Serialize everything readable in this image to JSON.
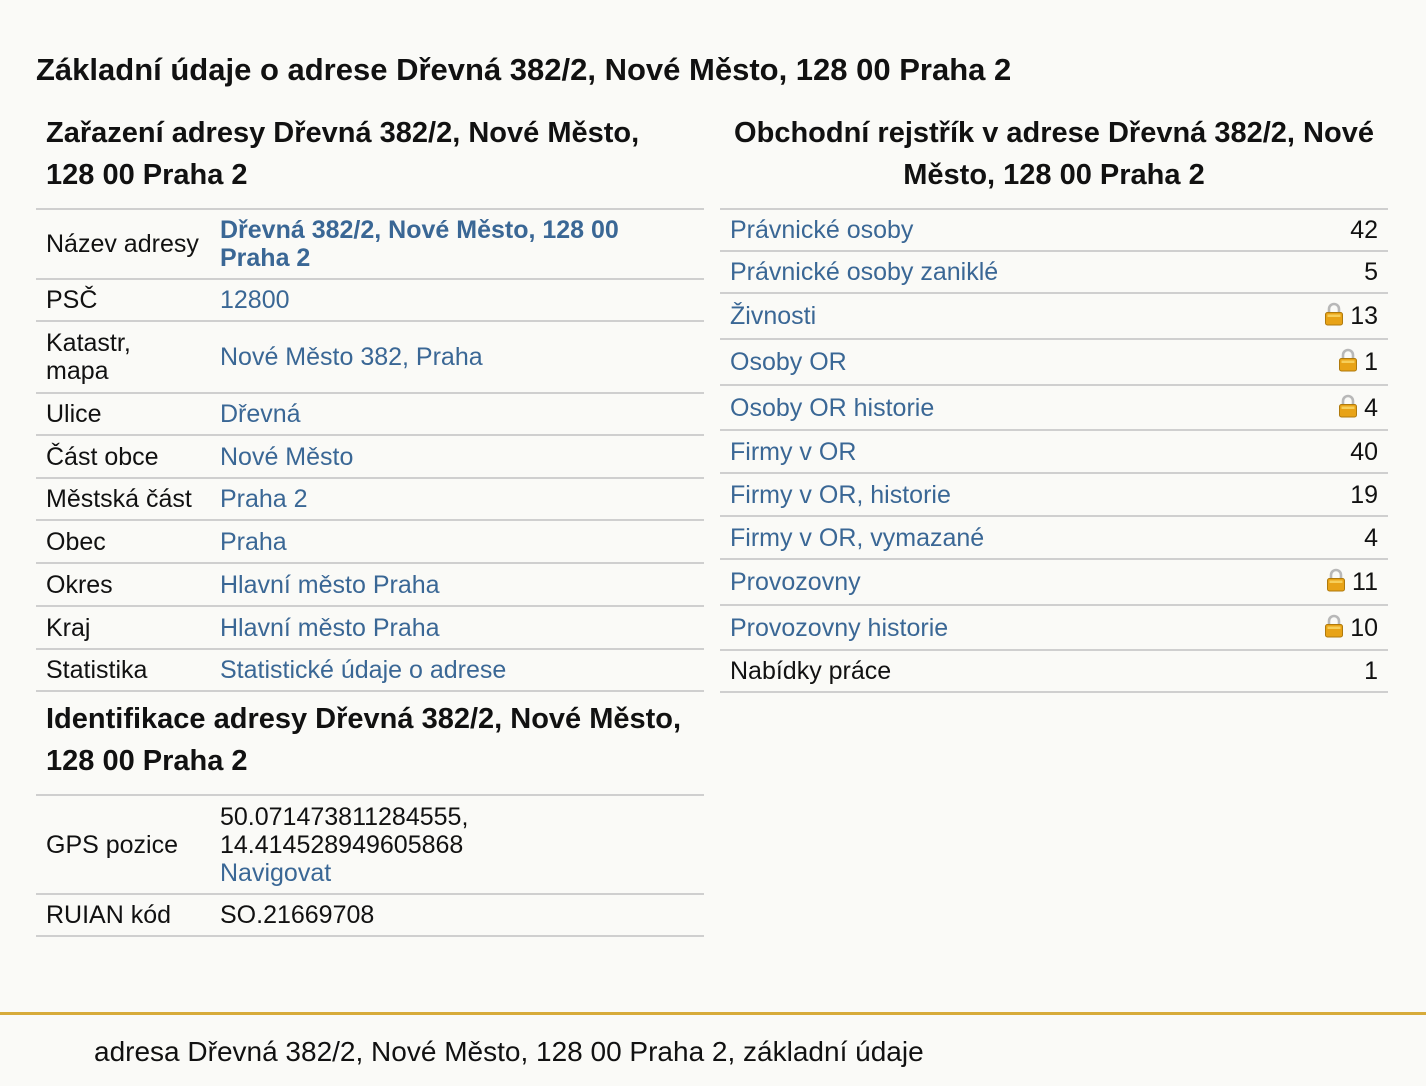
{
  "page": {
    "title": "Základní údaje o adrese Dřevná 382/2, Nové Město, 128 00 Praha 2",
    "footer": "adresa Dřevná 382/2, Nové Město, 128 00 Praha 2, základní údaje"
  },
  "classification": {
    "title": "Zařazení adresy Dřevná 382/2, Nové Město, 128 00 Praha 2",
    "rows": [
      {
        "label": "Název adresy",
        "value": "Dřevná 382/2, Nové Město, 128 00 Praha 2"
      },
      {
        "label": "PSČ",
        "value": "12800"
      },
      {
        "label": "Katastr, mapa",
        "value": "Nové Město 382, Praha"
      },
      {
        "label": "Ulice",
        "value": "Dřevná"
      },
      {
        "label": "Část obce",
        "value": "Nové Město"
      },
      {
        "label": "Městská část",
        "value": "Praha 2"
      },
      {
        "label": "Obec",
        "value": "Praha"
      },
      {
        "label": "Okres",
        "value": "Hlavní město Praha"
      },
      {
        "label": "Kraj",
        "value": "Hlavní město Praha"
      },
      {
        "label": "Statistika",
        "value": "Statistické údaje o adrese"
      }
    ]
  },
  "identification": {
    "title": "Identifikace adresy Dřevná 382/2, Nové Město, 128 00 Praha 2",
    "gps_label": "GPS pozice",
    "gps_lat": "50.071473811284555,",
    "gps_lon": "14.414528949605868",
    "gps_nav": "Navigovat",
    "ruian_label": "RUIAN kód",
    "ruian_value": "SO.21669708"
  },
  "registry": {
    "title": "Obchodní rejstřík v adrese Dřevná 382/2, Nové Město, 128 00 Praha 2",
    "rows": [
      {
        "label": "Právnické osoby",
        "count": "42",
        "locked": false,
        "link": true
      },
      {
        "label": "Právnické osoby zaniklé",
        "count": "5",
        "locked": false,
        "link": true
      },
      {
        "label": "Živnosti",
        "count": "13",
        "locked": true,
        "link": true
      },
      {
        "label": "Osoby OR",
        "count": "1",
        "locked": true,
        "link": true
      },
      {
        "label": "Osoby OR historie",
        "count": "4",
        "locked": true,
        "link": true
      },
      {
        "label": "Firmy v OR",
        "count": "40",
        "locked": false,
        "link": true
      },
      {
        "label": "Firmy v OR, historie",
        "count": "19",
        "locked": false,
        "link": true
      },
      {
        "label": "Firmy v OR, vymazané",
        "count": "4",
        "locked": false,
        "link": true
      },
      {
        "label": "Provozovny",
        "count": "11",
        "locked": true,
        "link": true
      },
      {
        "label": "Provozovny historie",
        "count": "10",
        "locked": true,
        "link": true
      },
      {
        "label": "Nabídky práce",
        "count": "1",
        "locked": false,
        "link": false
      }
    ],
    "lock_icon": "padlock-icon",
    "lock_color": "#e8a317"
  }
}
